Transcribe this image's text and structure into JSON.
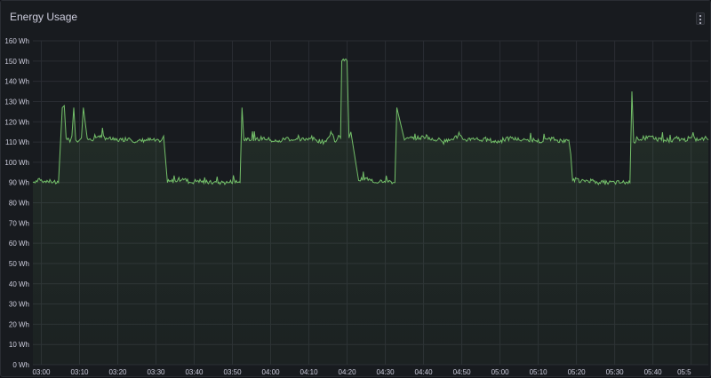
{
  "panel": {
    "title": "Energy Usage",
    "menu_icon": "vertical-ellipsis-icon"
  },
  "colors": {
    "background": "#181b1f",
    "series_line": "#73bf69",
    "grid": "#2a2d33",
    "text": "#ccccdc"
  },
  "chart_data": {
    "type": "area",
    "ylim": [
      0,
      160
    ],
    "yunit": "Wh",
    "y_ticks": [
      "0 Wh",
      "10 Wh",
      "20 Wh",
      "30 Wh",
      "40 Wh",
      "50 Wh",
      "60 Wh",
      "70 Wh",
      "80 Wh",
      "90 Wh",
      "100 Wh",
      "110 Wh",
      "120 Wh",
      "130 Wh",
      "140 Wh",
      "150 Wh",
      "160 Wh"
    ],
    "x_ticks": [
      "03:00",
      "03:10",
      "03:20",
      "03:30",
      "03:40",
      "03:50",
      "04:00",
      "04:10",
      "04:20",
      "04:30",
      "04:40",
      "04:50",
      "05:00",
      "05:10",
      "05:20",
      "05:30",
      "05:40",
      "05:5"
    ],
    "xlim_minutes": [
      177.8,
      354.5
    ],
    "grid": true,
    "legend": "none",
    "series": [
      {
        "x_minutes": [
          177.8,
          179.5,
          180.5,
          181.5,
          182,
          183,
          184.5,
          185.5,
          186,
          186.5,
          187.5,
          188,
          188.5,
          189,
          189.5,
          190,
          190.5,
          191,
          192,
          193,
          195,
          197,
          199,
          201,
          203,
          205,
          207,
          209,
          211,
          211.5,
          212,
          213,
          215,
          217,
          219,
          221,
          223,
          225,
          227,
          229,
          231,
          232,
          232.5,
          233,
          234,
          236,
          238,
          240,
          242,
          244,
          246,
          248,
          250,
          252,
          254,
          255,
          256,
          257,
          258,
          258.3,
          258.6,
          259,
          260,
          260.5,
          261,
          263,
          265,
          267,
          269,
          271,
          272,
          272.5,
          273,
          275,
          277,
          279,
          281,
          282,
          283,
          284,
          284.5,
          285,
          287,
          289,
          291,
          293,
          295,
          297,
          299,
          301,
          303,
          305,
          307,
          309,
          311,
          313,
          315,
          317,
          318,
          318.5,
          319,
          320,
          321,
          322,
          324,
          326,
          328,
          330,
          332,
          334,
          334.5,
          335,
          336,
          338,
          340,
          341,
          342,
          343,
          344,
          345,
          346,
          348,
          350,
          352,
          354,
          354.5
        ],
        "values": [
          90,
          92,
          90,
          91,
          90,
          90,
          90,
          127,
          128,
          112,
          110,
          113,
          127,
          111,
          110,
          111,
          112,
          127,
          112,
          111,
          113,
          112,
          111,
          111,
          112,
          110,
          111,
          111,
          110,
          111,
          113,
          90,
          91,
          92,
          90,
          91,
          90,
          90,
          90,
          90,
          91,
          90,
          127,
          111,
          112,
          111,
          112,
          111,
          110,
          112,
          111,
          111,
          112,
          111,
          110,
          112,
          114,
          110,
          113,
          112,
          150,
          151,
          150,
          112,
          115,
          91,
          92,
          90,
          91,
          91,
          90,
          90,
          127,
          111,
          112,
          112,
          113,
          111,
          111,
          112,
          111,
          110,
          111,
          113,
          111,
          112,
          111,
          111,
          110,
          111,
          112,
          111,
          111,
          111,
          110,
          112,
          111,
          110,
          111,
          104,
          91,
          92,
          90,
          91,
          91,
          90,
          90,
          90,
          90,
          90,
          135,
          110,
          112,
          111,
          113,
          111,
          112,
          111,
          111,
          110,
          112,
          111,
          112,
          111,
          112,
          111,
          110,
          111,
          121,
          112,
          110,
          111
        ]
      }
    ]
  }
}
